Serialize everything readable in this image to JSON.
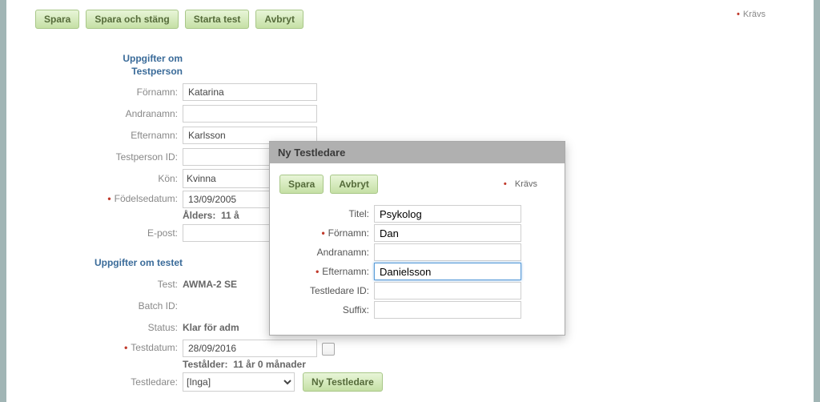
{
  "toolbar": {
    "save": "Spara",
    "save_close": "Spara och stäng",
    "start_test": "Starta test",
    "cancel": "Avbryt"
  },
  "required_label": "Krävs",
  "sections": {
    "testperson": {
      "title_l1": "Uppgifter om",
      "title_l2": "Testperson",
      "labels": {
        "fornamn": "Förnamn:",
        "andranamn": "Andranamn:",
        "efternamn": "Efternamn:",
        "testperson_id": "Testperson ID:",
        "kon": "Kön:",
        "fodelsedatum": "Födelsedatum:",
        "epost": "E-post:"
      },
      "values": {
        "fornamn": "Katarina",
        "andranamn": "",
        "efternamn": "Karlsson",
        "testperson_id": "",
        "kon_selected": "Kvinna",
        "fodelsedatum": "13/09/2005",
        "epost": ""
      },
      "age_label": "Ålders:",
      "age_value": "11 å"
    },
    "test": {
      "title": "Uppgifter om testet",
      "labels": {
        "test": "Test:",
        "batch_id": "Batch ID:",
        "status": "Status:",
        "testdatum": "Testdatum:",
        "testledare": "Testledare:"
      },
      "values": {
        "test": "AWMA-2 SE",
        "batch_id": "",
        "status": "Klar för adm",
        "testdatum": "28/09/2016",
        "testledare_selected": "[Inga]"
      },
      "testalder_label": "Testålder:",
      "testalder_value": "11 år 0 månader",
      "new_testledare_btn": "Ny Testledare"
    }
  },
  "dialog": {
    "title": "Ny Testledare",
    "save": "Spara",
    "cancel": "Avbryt",
    "required": "Krävs",
    "labels": {
      "titel": "Titel:",
      "fornamn": "Förnamn:",
      "andranamn": "Andranamn:",
      "efternamn": "Efternamn:",
      "testledare_id": "Testledare ID:",
      "suffix": "Suffix:"
    },
    "values": {
      "titel": "Psykolog",
      "fornamn": "Dan",
      "andranamn": "",
      "efternamn": "Danielsson",
      "testledare_id": "",
      "suffix": ""
    }
  }
}
